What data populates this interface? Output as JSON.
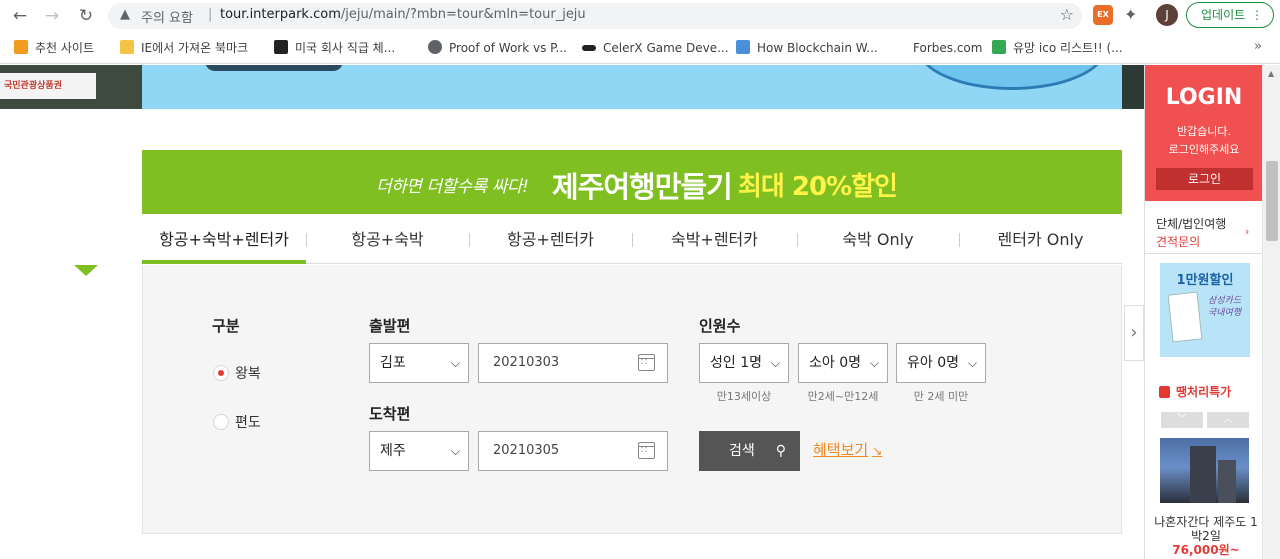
{
  "browser": {
    "warning_icon": "warning-triangle-icon",
    "warning_label": "주의 요함",
    "separator": "|",
    "url_host": "tour.interpark.com",
    "url_path": "/jeju/main/?mbn=tour&mln=tour_jeju",
    "ext_label": "EX",
    "avatar_letter": "J",
    "update_label": "업데이트",
    "update_menu": "⋮"
  },
  "bookmarks": {
    "items": [
      {
        "label": "추천 사이트",
        "color": "#f29b1d"
      },
      {
        "label": "IE에서 가져온 북마크",
        "color": "#f6c445"
      },
      {
        "label": "미국 회사 직급 체...",
        "color": "#222222"
      },
      {
        "label": "Proof of Work vs P...",
        "color": "#5f6368"
      },
      {
        "label": "CelerX Game Deve...",
        "color": "#222222"
      },
      {
        "label": "How Blockchain W...",
        "color": "#4a90d9"
      },
      {
        "label": "Forbes.com",
        "color": "#ffffff"
      },
      {
        "label": "유망 ico 리스트!! (...",
        "color": "#34a853"
      }
    ],
    "more": "»"
  },
  "banner": {
    "logo_text": "국민관광상품권"
  },
  "promo": {
    "sub": "더하면 더할수록 싸다!",
    "main": "제주여행만들기",
    "highlight": "최대 20%할인"
  },
  "tabs": [
    {
      "label": "항공+숙박+렌터카",
      "active": true
    },
    {
      "label": "항공+숙박",
      "active": false
    },
    {
      "label": "항공+렌터카",
      "active": false
    },
    {
      "label": "숙박+렌터카",
      "active": false
    },
    {
      "label": "숙박 Only",
      "active": false
    },
    {
      "label": "렌터카 Only",
      "active": false
    }
  ],
  "form": {
    "type_label": "구분",
    "round_trip": "왕복",
    "one_way": "편도",
    "selected_type": "왕복",
    "depart_label": "출발편",
    "depart_city": "김포",
    "depart_date": "20210303",
    "arrive_label": "도착편",
    "arrive_city": "제주",
    "arrive_date": "20210305",
    "pax_label": "인원수",
    "adult": "성인 1명",
    "child": "소아 0명",
    "infant": "유아 0명",
    "adult_hint": "만13세이상",
    "child_hint": "만2세~만12세",
    "infant_hint": "만 2세 미만",
    "search_label": "검색",
    "benefit_label": "혜택보기",
    "benefit_arrow": "↘"
  },
  "sidebar": {
    "login_title": "LOGIN",
    "login_msg1": "반갑습니다.",
    "login_msg2": "로그인해주세요",
    "login_button": "로그인",
    "group_line1": "단체/법인여행",
    "group_line2": "견적문의",
    "group_arrow": "›",
    "coupon_title": "1만원할인",
    "coupon_text": "삼성카드 국내여행",
    "deal_title": "땡처리특가",
    "deal_name1": "나혼자간다 제주도 1",
    "deal_name2": "박2일",
    "deal_price": "76,000원~"
  },
  "colors": {
    "accent_green": "#7fbf21",
    "login_red": "#f0504f",
    "benefit_orange": "#f08a24"
  }
}
